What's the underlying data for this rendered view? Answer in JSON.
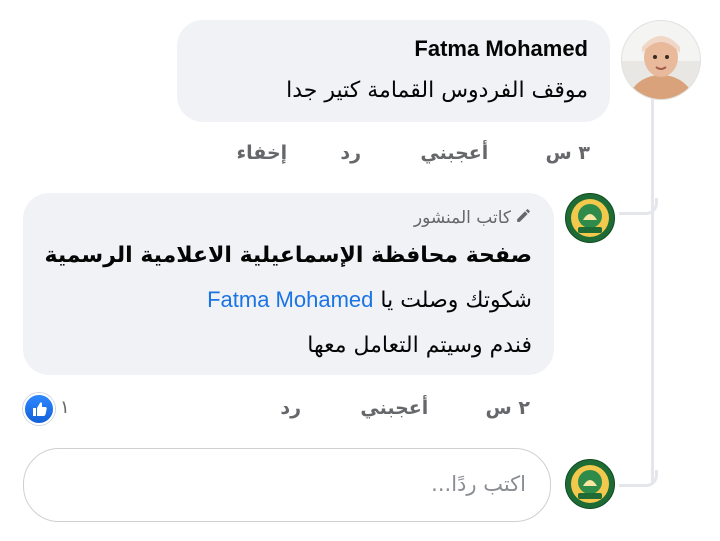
{
  "comment": {
    "author": "Fatma Mohamed",
    "text": "موقف الفردوس القمامة كتير جدا",
    "time": "٣ س",
    "like_label": "أعجبني",
    "reply_label": "رد",
    "hide_label": "إخفاء"
  },
  "reply": {
    "badge": "كاتب المنشور",
    "author": "صفحة محافظة الإسماعيلية الاعلامية الرسمية",
    "line1_text": "شكوتك وصلت يا",
    "mention": "Fatma Mohamed",
    "line2_text": "فندم وسيتم التعامل معها",
    "time": "٢ س",
    "like_label": "أعجبني",
    "reply_label": "رد",
    "reaction_count": "١",
    "reaction_icon": "like-thumb-icon"
  },
  "composer": {
    "placeholder": "اكتب ردًا..."
  },
  "colors": {
    "bubble": "#f0f2f5",
    "meta_text": "#65676b",
    "mention": "#1b74e4",
    "like_blue": "#1877f2",
    "thread_line": "#e4e6eb"
  }
}
